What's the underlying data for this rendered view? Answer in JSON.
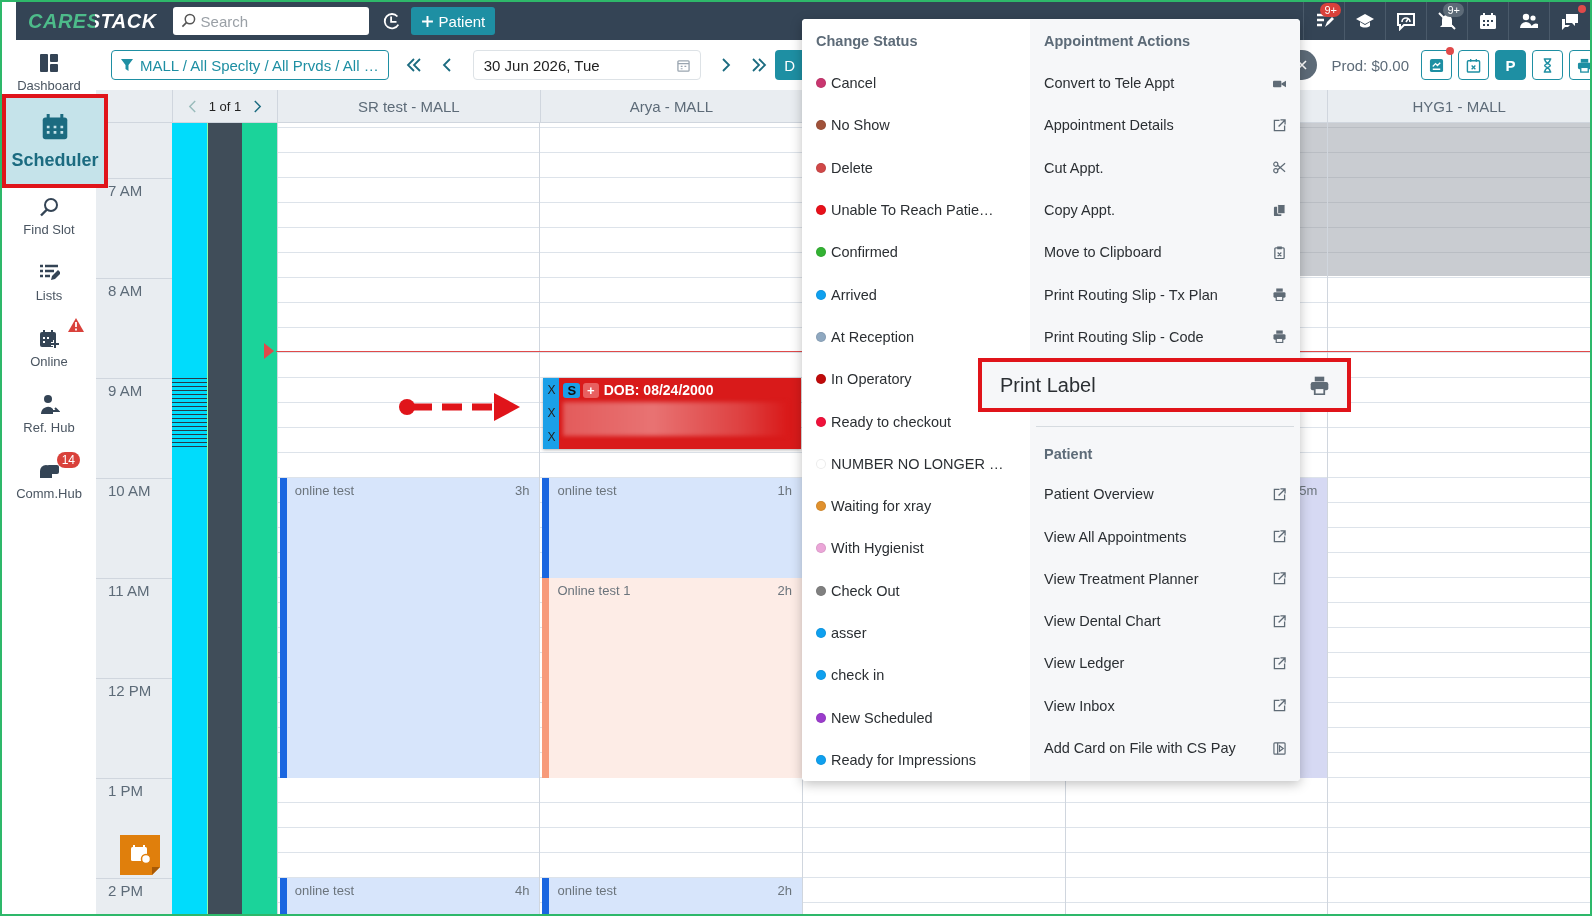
{
  "topbar": {
    "logo": "CARESTACK",
    "search": {
      "placeholder": "Search"
    },
    "add_patient_button": "Patient",
    "icons": [
      {
        "kind": "tasks",
        "badge": "9+"
      },
      {
        "kind": "training"
      },
      {
        "kind": "feedback"
      },
      {
        "kind": "bell-off",
        "badge": "9+"
      },
      {
        "kind": "calendar"
      },
      {
        "kind": "people"
      },
      {
        "kind": "chat",
        "dot": true
      }
    ]
  },
  "sidebar": {
    "items": [
      {
        "kind": "dashboard",
        "label": "Dashboard",
        "selected": false
      },
      {
        "kind": "scheduler",
        "label": "Scheduler",
        "selected": true
      },
      {
        "kind": "find",
        "label": "Find Slot",
        "selected": false
      },
      {
        "kind": "lists",
        "label": "Lists",
        "selected": false
      },
      {
        "kind": "online",
        "label": "Online",
        "selected": false,
        "warning": true
      },
      {
        "kind": "refhub",
        "label": "Ref. Hub",
        "selected": false
      },
      {
        "kind": "commhub",
        "label": "Comm.Hub",
        "selected": false,
        "badge": "14"
      }
    ]
  },
  "toolbar": {
    "filter": "MALL / All Speclty / All Prvds / All …",
    "date": "30 Jun 2026, Tue",
    "view_button": "D",
    "prod": "Prod: $0.00",
    "tools": [
      {
        "kind": "chart",
        "selected": false,
        "dot": true
      },
      {
        "kind": "calendar-x",
        "selected": false
      },
      {
        "kind": "letter",
        "label": "P",
        "selected": true
      },
      {
        "kind": "hourglass",
        "selected": false
      },
      {
        "kind": "print",
        "selected": false
      }
    ]
  },
  "pager": "1 of 1",
  "time_labels": [
    "7 AM",
    "8 AM",
    "9 AM",
    "10 AM",
    "11 AM",
    "12 PM",
    "1 PM",
    "2 PM"
  ],
  "columns": [
    {
      "title": "SR test - MALL",
      "appointments": [
        {
          "kind": "online",
          "title": "online test",
          "duration": "3h",
          "color": "#1a66e0"
        },
        {
          "kind": "online",
          "title": "online test",
          "duration": "4h",
          "color": "#1a66e0"
        }
      ]
    },
    {
      "title": "Arya - MALL",
      "appointments": [
        {
          "kind": "patient",
          "badge": "S",
          "plus": "+",
          "dob": "DOB: 08/24/2000",
          "marks": [
            "X",
            "X",
            "X"
          ]
        },
        {
          "kind": "online",
          "title": "online test",
          "duration": "1h",
          "color": "#1a66e0"
        },
        {
          "kind": "online",
          "title": "Online test 1",
          "duration": "2h",
          "color": "#f79a7a"
        },
        {
          "kind": "online",
          "title": "online test",
          "duration": "2h",
          "color": "#1a66e0"
        }
      ]
    },
    {},
    {
      "blocked": true,
      "appointments": [
        {
          "kind": "block",
          "duration": "5m"
        }
      ]
    },
    {
      "title": "HYG1 - MALL",
      "blocked": true
    }
  ],
  "menu": {
    "status": {
      "title": "Change Status",
      "items": [
        {
          "label": "Cancel",
          "color": "#c9366f"
        },
        {
          "label": "No Show",
          "color": "#a0523a"
        },
        {
          "label": "Delete",
          "color": "#d04848"
        },
        {
          "label": "Unable To Reach Patie…",
          "color": "#e8101a"
        },
        {
          "label": "Confirmed",
          "color": "#33b233"
        },
        {
          "label": "Arrived",
          "color": "#0fa0ef"
        },
        {
          "label": "At Reception",
          "color": "#8fa8c0"
        },
        {
          "label": "In Operatory",
          "color": "#c00a0a"
        },
        {
          "label": "Ready to checkout",
          "color": "#f0113a"
        },
        {
          "label": "NUMBER NO LONGER …",
          "color": "#ffffff"
        },
        {
          "label": "Waiting for xray",
          "color": "#e0912e"
        },
        {
          "label": "With Hygienist",
          "color": "#eba6d8"
        },
        {
          "label": "Check Out",
          "color": "#808080"
        },
        {
          "label": "asser",
          "color": "#0fa0ef"
        },
        {
          "label": "check in",
          "color": "#0fa0ef"
        },
        {
          "label": "New Scheduled",
          "color": "#9b3ccc"
        },
        {
          "label": "Ready for Impressions",
          "color": "#0fa0ef"
        }
      ]
    },
    "actions": {
      "title": "Appointment Actions",
      "items": [
        {
          "label": "Convert to Tele Appt",
          "highlighted": false
        },
        {
          "label": "Appointment Details",
          "highlighted": false
        },
        {
          "label": "Cut Appt.",
          "highlighted": false
        },
        {
          "label": "Copy Appt.",
          "highlighted": false
        },
        {
          "label": "Move to Clipboard",
          "highlighted": false
        },
        {
          "label": "Print Routing Slip - Tx Plan",
          "highlighted": false
        },
        {
          "label": "Print Routing Slip - Code",
          "highlighted": false
        },
        {
          "label": "Print Label",
          "highlighted": true
        }
      ]
    },
    "patient": {
      "title": "Patient",
      "items": [
        {
          "label": "Patient Overview"
        },
        {
          "label": "View All Appointments"
        },
        {
          "label": "View Treatment Planner"
        },
        {
          "label": "View Dental Chart"
        },
        {
          "label": "View Ledger"
        },
        {
          "label": "View Inbox"
        },
        {
          "label": "Add Card on File with CS Pay"
        }
      ]
    }
  }
}
